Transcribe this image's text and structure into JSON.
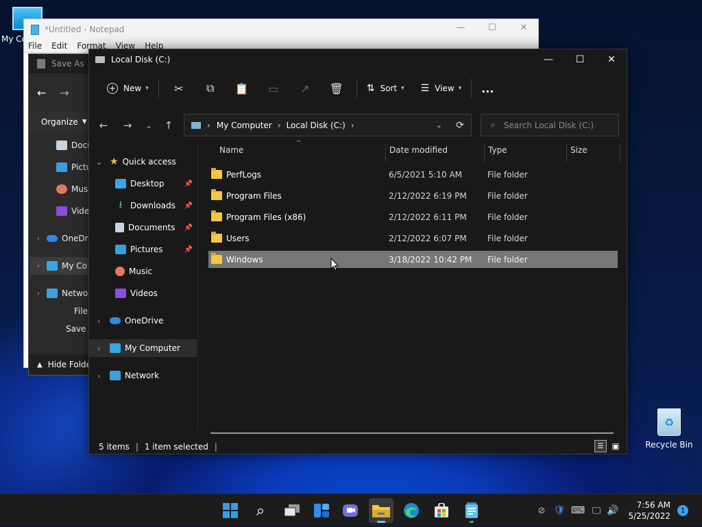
{
  "desktop": {
    "my_computer_label": "My Co",
    "recycle_bin_label": "Recycle Bin"
  },
  "notepad": {
    "title": "*Untitled - Notepad",
    "menu": [
      "File",
      "Edit",
      "Format",
      "View",
      "Help"
    ]
  },
  "save_as": {
    "title": "Save As",
    "organize": "Organize",
    "nav_items": [
      "Docu",
      "Pictur",
      "Music",
      "Video",
      "OneDriv",
      "My Co",
      "Networ"
    ],
    "file_label": "File",
    "save_label": "Save a",
    "hide_folders": "Hide Folde"
  },
  "explorer": {
    "title": "Local Disk (C:)",
    "toolbar": {
      "new_label": "New",
      "sort_label": "Sort",
      "view_label": "View",
      "more_label": "..."
    },
    "address": {
      "segments": [
        "My Computer",
        "Local Disk (C:)"
      ]
    },
    "search_placeholder": "Search Local Disk (C:)",
    "sidebar": {
      "quick_access": "Quick access",
      "pinned": [
        "Desktop",
        "Downloads",
        "Documents",
        "Pictures"
      ],
      "unpinned": [
        "Music",
        "Videos"
      ],
      "onedrive": "OneDrive",
      "my_computer": "My Computer",
      "network": "Network"
    },
    "columns": [
      "Name",
      "Date modified",
      "Type",
      "Size"
    ],
    "rows": [
      {
        "name": "PerfLogs",
        "date": "6/5/2021 5:10 AM",
        "type": "File folder"
      },
      {
        "name": "Program Files",
        "date": "2/12/2022 6:19 PM",
        "type": "File folder"
      },
      {
        "name": "Program Files (x86)",
        "date": "2/12/2022 6:11 PM",
        "type": "File folder"
      },
      {
        "name": "Users",
        "date": "2/12/2022 6:07 PM",
        "type": "File folder"
      },
      {
        "name": "Windows",
        "date": "3/18/2022 10:42 PM",
        "type": "File folder"
      }
    ],
    "selected_row": 4,
    "status": {
      "items": "5 items",
      "selected": "1 item selected"
    }
  },
  "taskbar": {
    "apps": [
      "start-icon",
      "search-icon",
      "task-view-icon",
      "widgets-icon",
      "chat-icon",
      "file-explorer-icon",
      "edge-icon",
      "store-icon",
      "notepad-icon"
    ],
    "time": "7:56 AM",
    "date": "5/25/2022",
    "notification_count": "1"
  },
  "colors": {
    "explorer_bg": "#191919",
    "selection": "#777777",
    "folder": "#f5c842",
    "accent": "#0078d4"
  }
}
